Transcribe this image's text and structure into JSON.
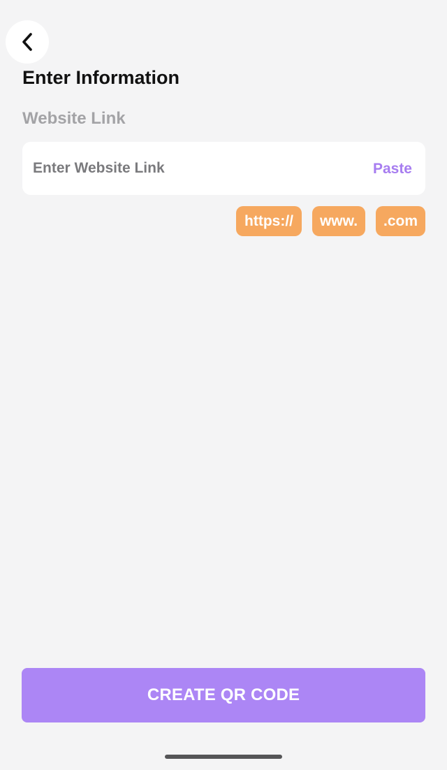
{
  "header": {
    "back_icon": "chevron-left-icon",
    "title": "Enter Information"
  },
  "form": {
    "label": "Website Link",
    "input": {
      "value": "",
      "placeholder": "Enter Website Link"
    },
    "paste_label": "Paste"
  },
  "chips": [
    {
      "label": "https://"
    },
    {
      "label": "www."
    },
    {
      "label": ".com"
    }
  ],
  "footer": {
    "create_label": "CREATE QR CODE"
  },
  "colors": {
    "background": "#f4f4f5",
    "accent": "#ac86f5",
    "paste": "#a77df0",
    "chip": "#f6a85f"
  }
}
